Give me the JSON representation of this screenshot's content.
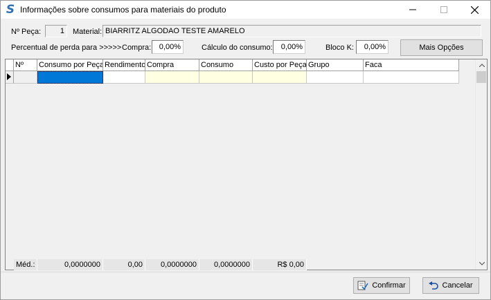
{
  "window": {
    "title": "Informações sobre consumos para materiais do produto"
  },
  "header": {
    "piece_number_label": "Nº Peça:",
    "piece_number_value": "1",
    "material_label": "Material:",
    "material_value": "BIARRITZ ALGODAO TESTE AMARELO",
    "loss_label": "Percentual de perda para >>>>>",
    "purchase_label": "Compra:",
    "purchase_value": "0,00%",
    "consumption_calc_label": "Cálculo do consumo:",
    "consumption_calc_value": "0,00%",
    "block_k_label": "Bloco K:",
    "block_k_value": "0,00%",
    "more_options_label": "Mais Opções"
  },
  "grid": {
    "columns": [
      "Nº",
      "Consumo por Peça",
      "Rendimento",
      "Compra",
      "Consumo",
      "Custo por Peça",
      "Grupo",
      "Faca"
    ],
    "footer": {
      "label": "Méd.:",
      "consumo_por_peca": "0,0000000",
      "rendimento": "0,00",
      "compra": "0,0000000",
      "consumo": "0,0000000",
      "custo_por_peca": "R$ 0,00"
    }
  },
  "buttons": {
    "confirm_label": "Confirmar",
    "cancel_label": "Cancelar"
  },
  "icons": {
    "app": "s-logo-icon",
    "minimize": "minimize-icon",
    "maximize": "maximize-icon",
    "close": "close-icon",
    "row_pointer": "row-pointer-icon",
    "confirm": "confirm-icon",
    "cancel": "undo-icon"
  }
}
